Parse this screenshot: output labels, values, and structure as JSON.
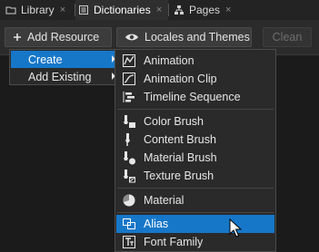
{
  "tabs": [
    {
      "label": "Library",
      "icon": "folder-icon",
      "close": "×"
    },
    {
      "label": "Dictionaries",
      "icon": "dictionary-icon",
      "close": "×"
    },
    {
      "label": "Pages",
      "icon": "pages-icon",
      "close": "×"
    }
  ],
  "toolbar": {
    "add_resource": {
      "icon": "plus-icon",
      "label": "Add Resource"
    },
    "locales_themes": {
      "icon": "eye-icon",
      "label": "Locales and Themes"
    },
    "clean": {
      "label": "Clean"
    }
  },
  "menu": {
    "create": "Create",
    "add_existing": "Add Existing"
  },
  "submenu": [
    {
      "label": "Animation",
      "icon": "animation-icon"
    },
    {
      "label": "Animation Clip",
      "icon": "animation-clip-icon"
    },
    {
      "label": "Timeline Sequence",
      "icon": "timeline-sequence-icon"
    },
    {
      "label": "Color Brush",
      "icon": "color-brush-icon"
    },
    {
      "label": "Content Brush",
      "icon": "content-brush-icon"
    },
    {
      "label": "Material Brush",
      "icon": "material-brush-icon"
    },
    {
      "label": "Texture Brush",
      "icon": "texture-brush-icon"
    },
    {
      "label": "Material",
      "icon": "material-icon"
    },
    {
      "label": "Alias",
      "icon": "alias-icon"
    },
    {
      "label": "Font Family",
      "icon": "font-family-icon"
    }
  ],
  "colors": {
    "highlight": "#1677c9",
    "background": "#1b1b1b",
    "menu_bg": "#2a2a2a"
  }
}
